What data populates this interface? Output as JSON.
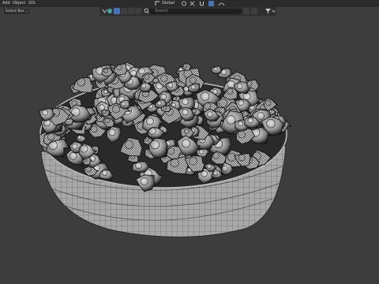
{
  "menu": {
    "items": [
      "Add",
      "Object",
      "GIS"
    ]
  },
  "header": {
    "select_box": "Select Box ⌄",
    "mode": "Global",
    "search_placeholder": "Search"
  },
  "gizmo": {
    "x_color": "#c43f3f",
    "y_color": "#6aa238",
    "z_color": "#3d73c4",
    "top_color": "#5a8fd6"
  },
  "colors": {
    "background": "#3d3d3d",
    "topbar": "#2b2b2b",
    "accent": "#4772b3",
    "mesh_light": "#c8c8c8",
    "mesh_dark": "#1b1b1b"
  }
}
